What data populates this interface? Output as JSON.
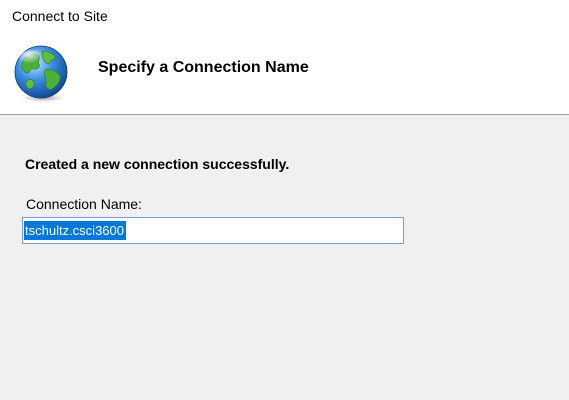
{
  "window": {
    "title": "Connect to Site"
  },
  "header": {
    "title": "Specify a Connection Name",
    "icon": "globe-icon"
  },
  "main": {
    "status_message": "Created a new connection successfully.",
    "connection_name_label": "Connection Name:",
    "connection_name_value": "tschultz.csci3600",
    "connection_name_selected": true
  },
  "colors": {
    "selection": "#0078d7",
    "input_border": "#7a9cd3",
    "content_background": "#f0f0f0",
    "header_background": "#ffffff"
  }
}
